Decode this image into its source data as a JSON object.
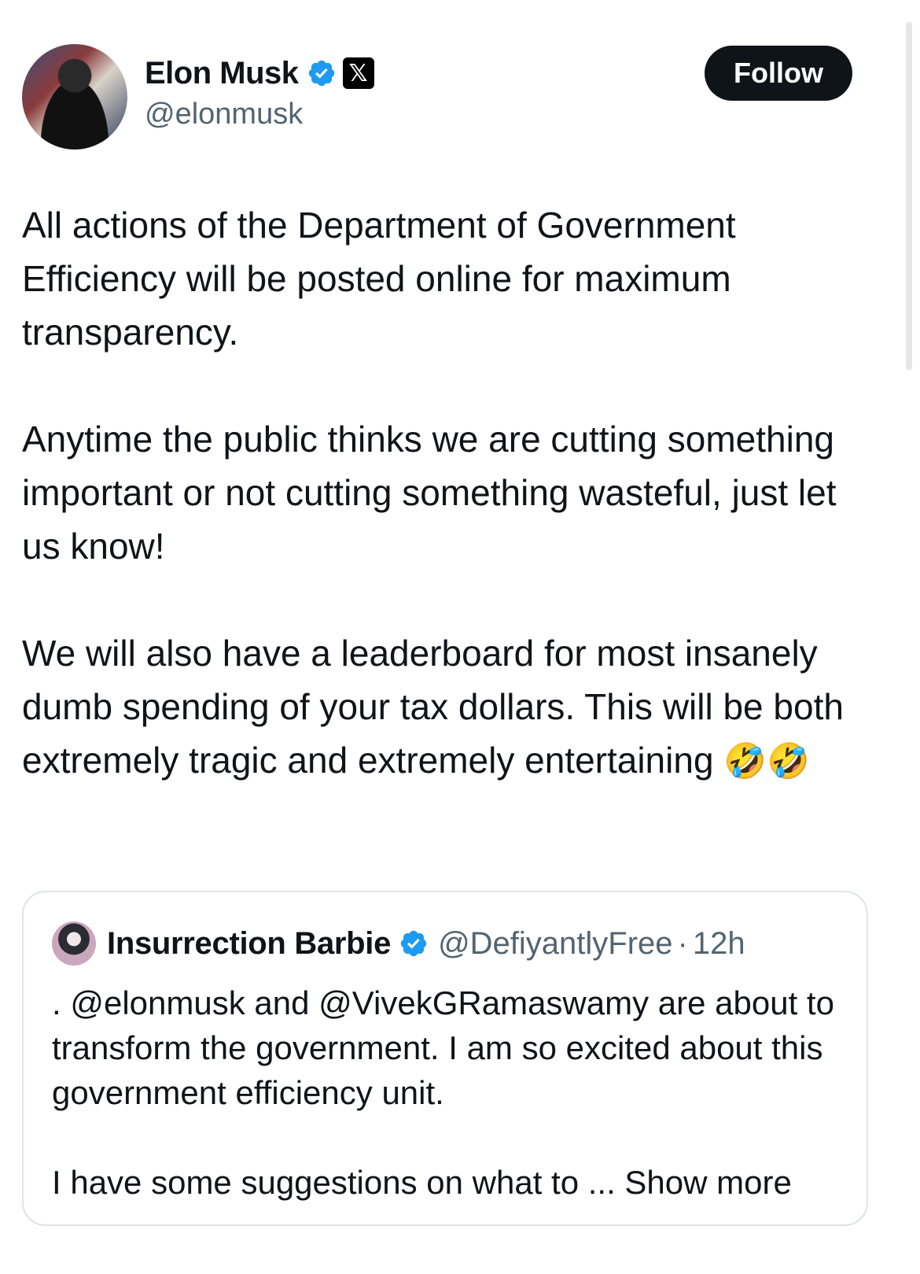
{
  "post": {
    "author_name": "Elon Musk",
    "author_handle": "@elonmusk",
    "follow_label": "Follow",
    "x_badge": "𝕏",
    "paragraph1": "All actions of the Department of Government Efficiency will be posted online for maximum transparency.",
    "paragraph2": "Anytime the public thinks we are cutting something important or not cutting something wasteful, just let us know!",
    "paragraph3_text": "We will also have a leaderboard for most insanely dumb spending of your tax dollars. This will be both extremely tragic and extremely entertaining ",
    "paragraph3_emoji": "🤣🤣"
  },
  "quote": {
    "author_name": "Insurrection Barbie",
    "author_handle": "@DefiyantlyFree",
    "separator": "·",
    "time": "12h",
    "text_line": ". @elonmusk and @VivekGRamaswamy are about to transform the government. I am so excited about this government efficiency unit.",
    "text_more": "I have some suggestions on what to ... Show more"
  },
  "icons": {
    "verified": "verified-badge-icon",
    "x_logo": "x-logo-icon"
  },
  "colors": {
    "verified_blue": "#1d9bf0",
    "text_primary": "#0f1419",
    "text_secondary": "#536471",
    "follow_bg": "#0f1419"
  }
}
